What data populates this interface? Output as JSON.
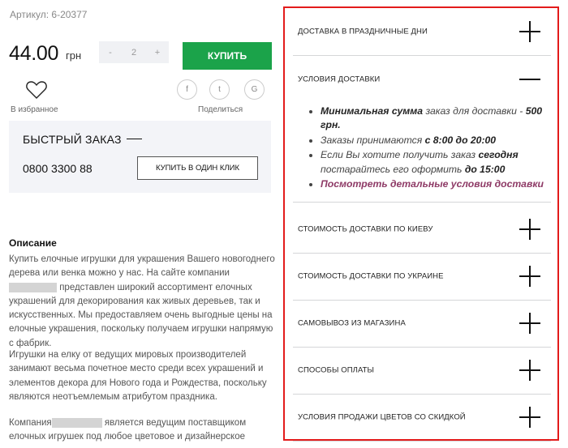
{
  "product": {
    "sku": "Артикул: 6-20377",
    "price": "44.00",
    "currency": "грн",
    "quantity": "2",
    "minus": "-",
    "plus": "+",
    "buy_label": "КУПИТЬ",
    "favorites_label": "В избранное",
    "share_label": "Поделиться",
    "social": [
      "f",
      "t",
      "G"
    ]
  },
  "quick_order": {
    "title": "БЫСТРЫЙ ЗАКАЗ",
    "phone": "0800 3300 88",
    "button_label": "КУПИТЬ В ОДИН КЛИК"
  },
  "description": {
    "title": "Описание",
    "p1_a": "Купить елочные игрушки для украшения Вашего новогоднего дерева или венка можно у нас. На сайте компании",
    "p1_b": "представлен широкий ассортимент елочных украшений для декорирования как живых деревьев, так и искусственных. Мы предоставляем очень выгодные цены на елочные украшения, поскольку получаем игрушки напрямую с фабрик.",
    "p2": "Игрушки на елку от ведущих мировых производителей занимают весьма почетное место среди всех украшений и элементов декора для Нового года и Рождества, поскольку являются неотъемлемым атрибутом праздника.",
    "p3_a": "Компания",
    "p3_b": "является ведущим поставщиком елочных игрушек под любое цветовое и дизайнерское"
  },
  "delivery": {
    "sections": [
      {
        "label": "ДОСТАВКА В ПРАЗДНИЧНЫЕ ДНИ",
        "expanded": false
      },
      {
        "label": "УСЛОВИЯ ДОСТАВКИ",
        "expanded": true
      },
      {
        "label": "СТОИМОСТЬ ДОСТАВКИ ПО КИЕВУ",
        "expanded": false
      },
      {
        "label": "СТОИМОСТЬ ДОСТАВКИ ПО УКРАИНЕ",
        "expanded": false
      },
      {
        "label": "САМОВЫВОЗ ИЗ МАГАЗИНА",
        "expanded": false
      },
      {
        "label": "СПОСОБЫ ОПЛАТЫ",
        "expanded": false
      },
      {
        "label": "УСЛОВИЯ ПРОДАЖИ ЦВЕТОВ СО СКИДКОЙ",
        "expanded": false
      }
    ],
    "conditions": {
      "item1_bold": "Минимальная сумма",
      "item1_rest": " заказ для доставки - ",
      "item1_amount": "500 грн.",
      "item2_a": "Заказы принимаются ",
      "item2_b": "с 8:00 до 20:00",
      "item3_a": "Если Вы хотите получить заказ ",
      "item3_b": "сегодня",
      "item3_c": " постарайтесь его оформить ",
      "item3_d": "до 15:00",
      "item4_link": "Посмотреть детальные условия доставки"
    }
  },
  "colors": {
    "buy_button": "#1ba34a",
    "highlight_border": "#e31b1b",
    "link": "#8e3a66"
  }
}
